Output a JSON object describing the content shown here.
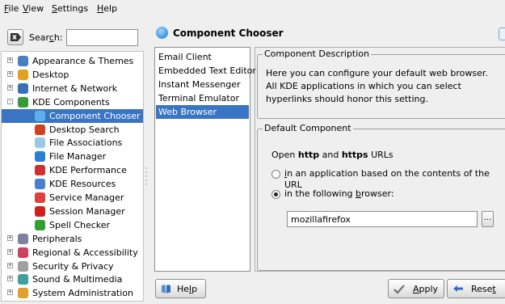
{
  "menubar": {
    "items": [
      {
        "pre": "",
        "key": "F",
        "post": "ile"
      },
      {
        "pre": "",
        "key": "V",
        "post": "iew"
      },
      {
        "pre": "",
        "key": "S",
        "post": "ettings"
      },
      {
        "pre": "",
        "key": "H",
        "post": "elp"
      }
    ]
  },
  "search": {
    "label_pre": "Sear",
    "label_key": "c",
    "label_post": "h:",
    "value": ""
  },
  "tree": {
    "items": [
      {
        "label": "Appearance & Themes",
        "expander": "+",
        "icon": "appearance-icon",
        "color": "#4a7fc1"
      },
      {
        "label": "Desktop",
        "expander": "+",
        "icon": "desktop-icon",
        "color": "#e0a020"
      },
      {
        "label": "Internet & Network",
        "expander": "+",
        "icon": "globe-icon",
        "color": "#3b6fb8"
      },
      {
        "label": "KDE Components",
        "expander": "−",
        "icon": "kde-components-icon",
        "color": "#3a9a3a"
      },
      {
        "label": "Component Chooser",
        "icon": "component-chooser-icon",
        "color": "#5fb0ea",
        "selected": true
      },
      {
        "label": "Desktop Search",
        "icon": "desktop-search-icon",
        "color": "#d04020"
      },
      {
        "label": "File Associations",
        "icon": "file-associations-icon",
        "color": "#9cc8e8"
      },
      {
        "label": "File Manager",
        "icon": "file-manager-icon",
        "color": "#2a7fd0"
      },
      {
        "label": "KDE Performance",
        "icon": "performance-icon",
        "color": "#d03030"
      },
      {
        "label": "KDE Resources",
        "icon": "resources-icon",
        "color": "#4a7fd0"
      },
      {
        "label": "Service Manager",
        "icon": "service-manager-icon",
        "color": "#e04040"
      },
      {
        "label": "Session Manager",
        "icon": "session-manager-icon",
        "color": "#d02020"
      },
      {
        "label": "Spell Checker",
        "icon": "spell-checker-icon",
        "color": "#30a030"
      },
      {
        "label": "Peripherals",
        "expander": "+",
        "icon": "peripherals-icon",
        "color": "#8080a0"
      },
      {
        "label": "Regional & Accessibility",
        "expander": "+",
        "icon": "regional-icon",
        "color": "#d04060"
      },
      {
        "label": "Security & Privacy",
        "expander": "+",
        "icon": "security-icon",
        "color": "#a0a0a0"
      },
      {
        "label": "Sound & Multimedia",
        "expander": "+",
        "icon": "sound-icon",
        "color": "#40a0a0"
      },
      {
        "label": "System Administration",
        "expander": "+",
        "icon": "system-admin-icon",
        "color": "#e0a030"
      }
    ]
  },
  "header": {
    "title": "Component Chooser"
  },
  "components": {
    "items": [
      {
        "label": "Email Client"
      },
      {
        "label": "Embedded Text Editor"
      },
      {
        "label": "Instant Messenger"
      },
      {
        "label": "Terminal Emulator"
      },
      {
        "label": "Web Browser",
        "selected": true
      }
    ]
  },
  "description": {
    "title": "Component Description",
    "text": "Here you can configure your default web browser. All KDE applications in which you can select hyperlinks should honor this setting."
  },
  "default_component": {
    "title": "Default Component",
    "open_pre": "Open ",
    "open_b1": "http",
    "open_mid": " and ",
    "open_b2": "https",
    "open_post": " URLs",
    "radio1_key": "i",
    "radio1_rest": "n an application based on the contents of the URL",
    "radio2_pre": "in the following ",
    "radio2_key": "b",
    "radio2_post": "rowser:",
    "browser_value": "mozillafirefox",
    "browse_label": "...",
    "selected_option": "in the following browser"
  },
  "buttons": {
    "help_pre": "He",
    "help_key": "l",
    "help_post": "p",
    "apply_key": "A",
    "apply_post": "pply",
    "reset_pre": "Rese",
    "reset_key": "t"
  },
  "colors": {
    "selection": "#3a75c4",
    "background": "#efefef"
  }
}
